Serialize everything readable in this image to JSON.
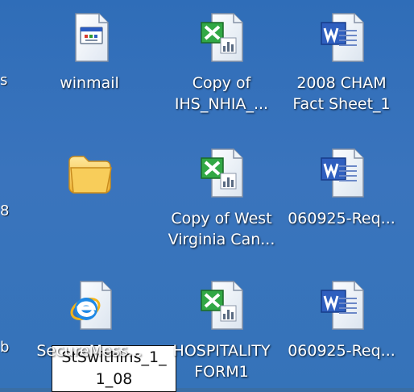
{
  "desktop": {
    "edge_labels": [
      "s",
      "8\n.",
      "b\n."
    ],
    "icons": [
      {
        "label": "winmail",
        "type": "program"
      },
      {
        "label": "Copy of\nIHS_NHIA_...",
        "type": "excel"
      },
      {
        "label": "2008 CHAM\nFact Sheet_1",
        "type": "word"
      },
      {
        "label": "StSwithins_1_\n1_08",
        "type": "folder",
        "selected": true
      },
      {
        "label": "Copy of West\nVirginia Can...",
        "type": "excel"
      },
      {
        "label": "060925-Req...",
        "type": "word"
      },
      {
        "label": "SecureMess...",
        "type": "internet-explorer"
      },
      {
        "label": "HOSPITALITY\nFORM1",
        "type": "excel"
      },
      {
        "label": "060925-Req...",
        "type": "word"
      }
    ]
  },
  "colors": {
    "desktop": "#3573b9",
    "excel": "#2f9b33",
    "word": "#2f5fbf",
    "folder": "#f2c04d",
    "ie": "#1e88e5"
  }
}
